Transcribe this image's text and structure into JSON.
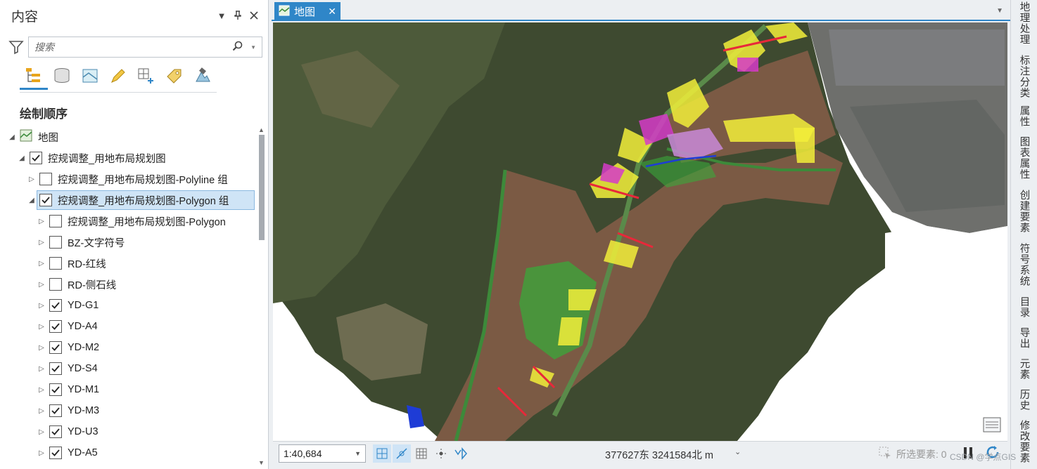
{
  "contents": {
    "title": "内容",
    "search_placeholder": "搜索",
    "section_title": "绘制顺序",
    "tree": [
      {
        "label": "地图",
        "indent": 0,
        "expanded": true,
        "checkbox": false,
        "map_icon": true
      },
      {
        "label": "控规调整_用地布局规划图",
        "indent": 1,
        "expanded": true,
        "checkbox": true,
        "checked": true
      },
      {
        "label": "控规调整_用地布局规划图-Polyline 组",
        "indent": 2,
        "expanded": false,
        "checkbox": true,
        "checked": false
      },
      {
        "label": "控规调整_用地布局规划图-Polygon 组",
        "indent": 2,
        "expanded": true,
        "checkbox": true,
        "checked": true,
        "selected": true
      },
      {
        "label": "控规调整_用地布局规划图-Polygon",
        "indent": 3,
        "expanded": false,
        "checkbox": true,
        "checked": false
      },
      {
        "label": "BZ-文字符号",
        "indent": 3,
        "expanded": false,
        "checkbox": true,
        "checked": false
      },
      {
        "label": "RD-红线",
        "indent": 3,
        "expanded": false,
        "checkbox": true,
        "checked": false
      },
      {
        "label": "RD-侧石线",
        "indent": 3,
        "expanded": false,
        "checkbox": true,
        "checked": false
      },
      {
        "label": "YD-G1",
        "indent": 3,
        "expanded": false,
        "checkbox": true,
        "checked": true
      },
      {
        "label": "YD-A4",
        "indent": 3,
        "expanded": false,
        "checkbox": true,
        "checked": true
      },
      {
        "label": "YD-M2",
        "indent": 3,
        "expanded": false,
        "checkbox": true,
        "checked": true
      },
      {
        "label": "YD-S4",
        "indent": 3,
        "expanded": false,
        "checkbox": true,
        "checked": true
      },
      {
        "label": "YD-M1",
        "indent": 3,
        "expanded": false,
        "checkbox": true,
        "checked": true
      },
      {
        "label": "YD-M3",
        "indent": 3,
        "expanded": false,
        "checkbox": true,
        "checked": true
      },
      {
        "label": "YD-U3",
        "indent": 3,
        "expanded": false,
        "checkbox": true,
        "checked": true
      },
      {
        "label": "YD-A5",
        "indent": 3,
        "expanded": false,
        "checkbox": true,
        "checked": true
      }
    ]
  },
  "map": {
    "tab_label": "地图",
    "scale": "1:40,684",
    "coordinates": "377627东 3241584北 m",
    "selected_features": "所选要素: 0"
  },
  "right_dock": {
    "tabs": [
      "地理处理",
      "标注分类",
      "属性",
      "图表属性",
      "创建要素",
      "符号系统",
      "目录",
      "导出",
      "元素",
      "历史",
      "修改要素"
    ]
  },
  "watermark": "CSDN @学点GIS",
  "colors": {
    "accent": "#2f86c8",
    "selection_fill": "#cfe4f6",
    "landuse_yellow": "#f2ee3a",
    "landuse_magenta": "#d63bc8",
    "landuse_green": "#3aa83a",
    "landuse_brown": "#8a5a3c",
    "road_red": "#e8283a",
    "water_blue": "#1e3cd6"
  }
}
